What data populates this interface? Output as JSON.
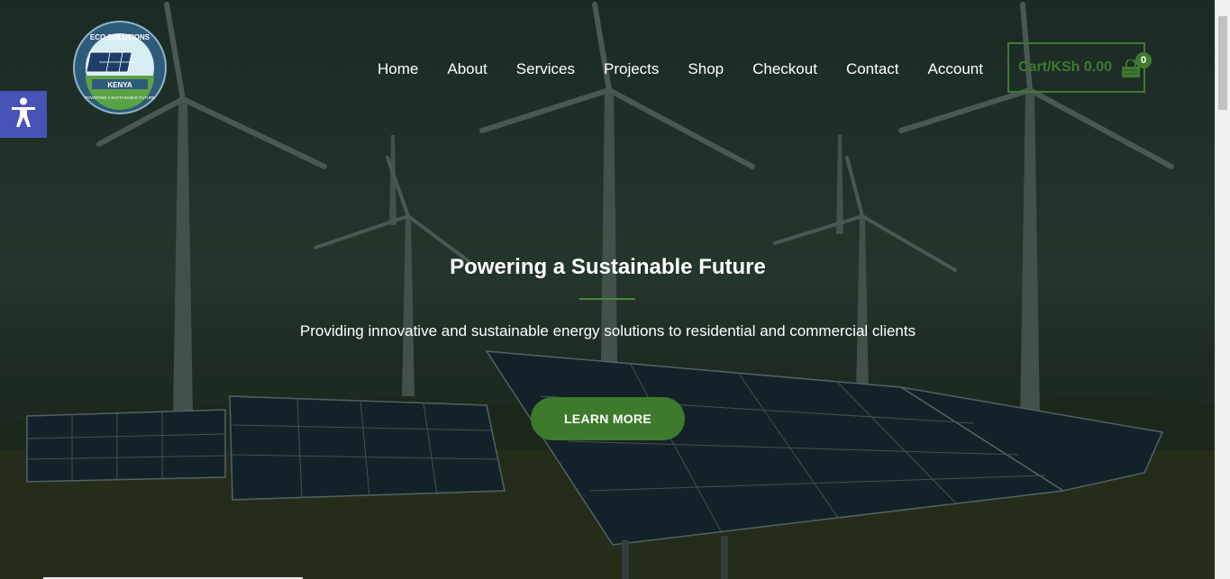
{
  "brand": {
    "logo_top_text": "ECO SOLUTIONS",
    "logo_country": "KENYA",
    "logo_bottom_text": "POWERING A SUSTAINABLE FUTURE",
    "accent_color": "#3f7a2f"
  },
  "nav": {
    "items": [
      {
        "label": "Home"
      },
      {
        "label": "About"
      },
      {
        "label": "Services"
      },
      {
        "label": "Projects"
      },
      {
        "label": "Shop"
      },
      {
        "label": "Checkout"
      },
      {
        "label": "Contact"
      },
      {
        "label": "Account"
      }
    ]
  },
  "cart": {
    "label": "Cart/KSh 0.00",
    "count": "0",
    "icon": "shopping-bag-icon"
  },
  "accessibility": {
    "icon": "accessibility-person-icon",
    "color": "#4654b8"
  },
  "hero": {
    "title": "Powering a Sustainable Future",
    "subtitle": "Providing innovative and sustainable energy solutions to residential and commercial clients",
    "cta_label": "LEARN MORE"
  }
}
